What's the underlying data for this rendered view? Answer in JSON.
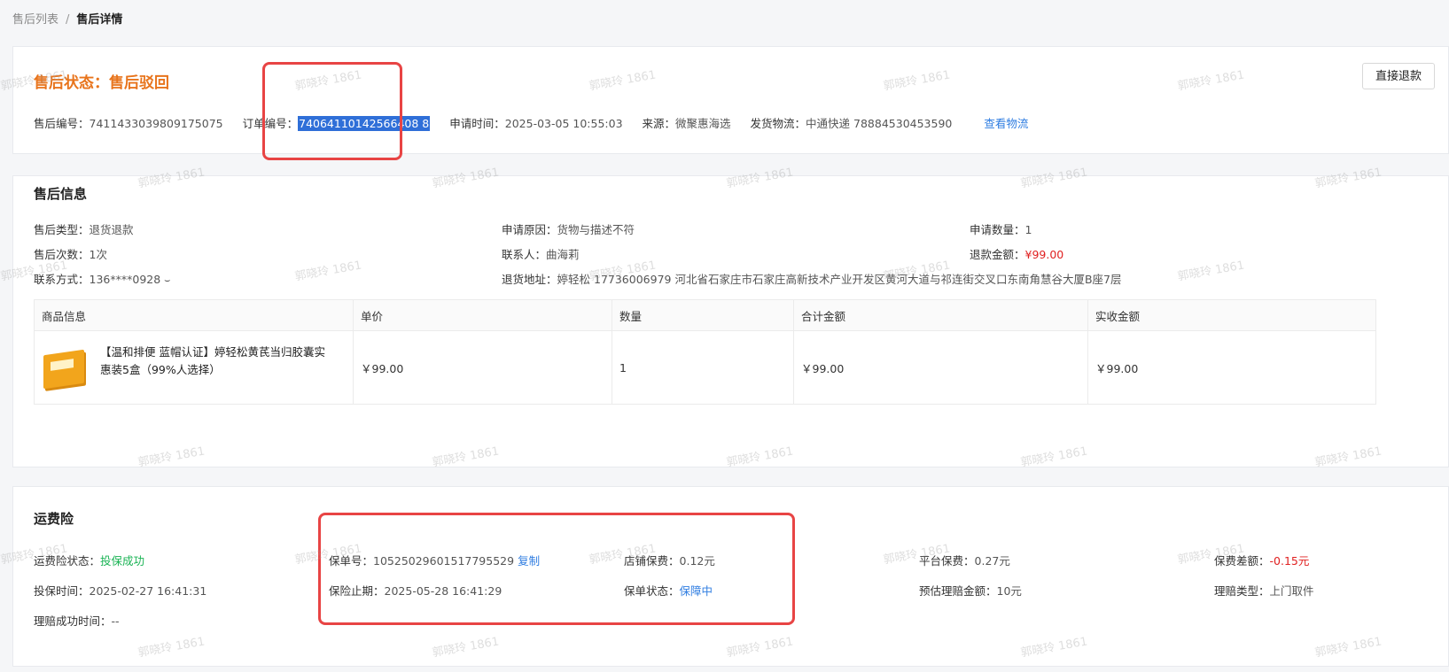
{
  "breadcrumb": {
    "parent": "售后列表",
    "separator": "/",
    "current": "售后详情"
  },
  "status": {
    "text": "售后状态：售后驳回"
  },
  "refund_button": "直接退款",
  "meta": {
    "aftersale_no_label": "售后编号：",
    "aftersale_no": "7411433039809175075",
    "order_no_label": "订单编号：",
    "order_no": "74064110142566408  8",
    "apply_time_label": "申请时间：",
    "apply_time": "2025-03-05 10:55:03",
    "source_label": "来源：",
    "source": "微聚惠海选",
    "logistics_label": "发货物流：",
    "logistics": "中通快递 78884530453590",
    "view_logistics": "查看物流"
  },
  "aftersale_info": {
    "title": "售后信息",
    "type_label": "售后类型：",
    "type": "退货退款",
    "reason_label": "申请原因：",
    "reason": "货物与描述不符",
    "qty_label": "申请数量：",
    "qty": "1",
    "times_label": "售后次数：",
    "times": "1次",
    "contact_label": "联系人：",
    "contact": "曲海莉",
    "refund_label": "退款金额：",
    "refund": "¥99.00",
    "phone_label": "联系方式：",
    "phone": "136****0928",
    "address_label": "退货地址：",
    "address": "婷轻松 17736006979 河北省石家庄市石家庄高新技术产业开发区黄河大道与祁连街交叉口东南角慧谷大厦B座7层"
  },
  "goods_table": {
    "headers": [
      "商品信息",
      "单价",
      "数量",
      "合计金额",
      "实收金额"
    ],
    "row": {
      "name": "【温和排便 蓝帽认证】婷轻松黄芪当归胶囊实惠装5盒（99%人选择）",
      "price": "￥99.00",
      "qty": "1",
      "total": "￥99.00",
      "received": "￥99.00"
    }
  },
  "insurance": {
    "title": "运费险",
    "status_label": "运费险状态：",
    "status": "投保成功",
    "policy_no_label": "保单号：",
    "policy_no": "10525029601517795529",
    "copy": "复制",
    "shop_fee_label": "店铺保费：",
    "shop_fee": "0.12元",
    "platform_fee_label": "平台保费：",
    "platform_fee": "0.27元",
    "diff_label": "保费差额：",
    "diff": "-0.15元",
    "insure_time_label": "投保时间：",
    "insure_time": "2025-02-27 16:41:31",
    "expire_label": "保险止期：",
    "expire": "2025-05-28 16:41:29",
    "policy_status_label": "保单状态：",
    "policy_status": "保障中",
    "est_claim_label": "预估理赔金额：",
    "est_claim": "10元",
    "claim_type_label": "理赔类型：",
    "claim_type": "上门取件",
    "claim_success_label": "理赔成功时间：",
    "claim_success": "--"
  },
  "watermark": "郭晓玲 1861",
  "colors": {
    "accent_orange": "#e8741c",
    "link_blue": "#2f7de1",
    "success_green": "#19b354",
    "alert_red": "#e02020",
    "frame_red": "#e84444"
  }
}
